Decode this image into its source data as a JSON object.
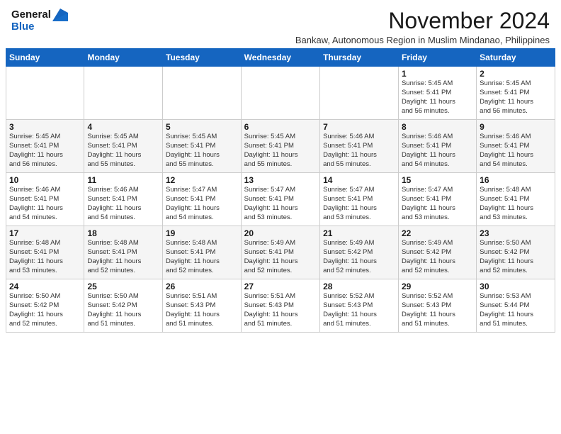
{
  "logo": {
    "general": "General",
    "blue": "Blue"
  },
  "header": {
    "month": "November 2024",
    "subtitle": "Bankaw, Autonomous Region in Muslim Mindanao, Philippines"
  },
  "weekdays": [
    "Sunday",
    "Monday",
    "Tuesday",
    "Wednesday",
    "Thursday",
    "Friday",
    "Saturday"
  ],
  "weeks": [
    [
      {
        "day": "",
        "info": ""
      },
      {
        "day": "",
        "info": ""
      },
      {
        "day": "",
        "info": ""
      },
      {
        "day": "",
        "info": ""
      },
      {
        "day": "",
        "info": ""
      },
      {
        "day": "1",
        "info": "Sunrise: 5:45 AM\nSunset: 5:41 PM\nDaylight: 11 hours\nand 56 minutes."
      },
      {
        "day": "2",
        "info": "Sunrise: 5:45 AM\nSunset: 5:41 PM\nDaylight: 11 hours\nand 56 minutes."
      }
    ],
    [
      {
        "day": "3",
        "info": "Sunrise: 5:45 AM\nSunset: 5:41 PM\nDaylight: 11 hours\nand 56 minutes."
      },
      {
        "day": "4",
        "info": "Sunrise: 5:45 AM\nSunset: 5:41 PM\nDaylight: 11 hours\nand 55 minutes."
      },
      {
        "day": "5",
        "info": "Sunrise: 5:45 AM\nSunset: 5:41 PM\nDaylight: 11 hours\nand 55 minutes."
      },
      {
        "day": "6",
        "info": "Sunrise: 5:45 AM\nSunset: 5:41 PM\nDaylight: 11 hours\nand 55 minutes."
      },
      {
        "day": "7",
        "info": "Sunrise: 5:46 AM\nSunset: 5:41 PM\nDaylight: 11 hours\nand 55 minutes."
      },
      {
        "day": "8",
        "info": "Sunrise: 5:46 AM\nSunset: 5:41 PM\nDaylight: 11 hours\nand 54 minutes."
      },
      {
        "day": "9",
        "info": "Sunrise: 5:46 AM\nSunset: 5:41 PM\nDaylight: 11 hours\nand 54 minutes."
      }
    ],
    [
      {
        "day": "10",
        "info": "Sunrise: 5:46 AM\nSunset: 5:41 PM\nDaylight: 11 hours\nand 54 minutes."
      },
      {
        "day": "11",
        "info": "Sunrise: 5:46 AM\nSunset: 5:41 PM\nDaylight: 11 hours\nand 54 minutes."
      },
      {
        "day": "12",
        "info": "Sunrise: 5:47 AM\nSunset: 5:41 PM\nDaylight: 11 hours\nand 54 minutes."
      },
      {
        "day": "13",
        "info": "Sunrise: 5:47 AM\nSunset: 5:41 PM\nDaylight: 11 hours\nand 53 minutes."
      },
      {
        "day": "14",
        "info": "Sunrise: 5:47 AM\nSunset: 5:41 PM\nDaylight: 11 hours\nand 53 minutes."
      },
      {
        "day": "15",
        "info": "Sunrise: 5:47 AM\nSunset: 5:41 PM\nDaylight: 11 hours\nand 53 minutes."
      },
      {
        "day": "16",
        "info": "Sunrise: 5:48 AM\nSunset: 5:41 PM\nDaylight: 11 hours\nand 53 minutes."
      }
    ],
    [
      {
        "day": "17",
        "info": "Sunrise: 5:48 AM\nSunset: 5:41 PM\nDaylight: 11 hours\nand 53 minutes."
      },
      {
        "day": "18",
        "info": "Sunrise: 5:48 AM\nSunset: 5:41 PM\nDaylight: 11 hours\nand 52 minutes."
      },
      {
        "day": "19",
        "info": "Sunrise: 5:48 AM\nSunset: 5:41 PM\nDaylight: 11 hours\nand 52 minutes."
      },
      {
        "day": "20",
        "info": "Sunrise: 5:49 AM\nSunset: 5:41 PM\nDaylight: 11 hours\nand 52 minutes."
      },
      {
        "day": "21",
        "info": "Sunrise: 5:49 AM\nSunset: 5:42 PM\nDaylight: 11 hours\nand 52 minutes."
      },
      {
        "day": "22",
        "info": "Sunrise: 5:49 AM\nSunset: 5:42 PM\nDaylight: 11 hours\nand 52 minutes."
      },
      {
        "day": "23",
        "info": "Sunrise: 5:50 AM\nSunset: 5:42 PM\nDaylight: 11 hours\nand 52 minutes."
      }
    ],
    [
      {
        "day": "24",
        "info": "Sunrise: 5:50 AM\nSunset: 5:42 PM\nDaylight: 11 hours\nand 52 minutes."
      },
      {
        "day": "25",
        "info": "Sunrise: 5:50 AM\nSunset: 5:42 PM\nDaylight: 11 hours\nand 51 minutes."
      },
      {
        "day": "26",
        "info": "Sunrise: 5:51 AM\nSunset: 5:43 PM\nDaylight: 11 hours\nand 51 minutes."
      },
      {
        "day": "27",
        "info": "Sunrise: 5:51 AM\nSunset: 5:43 PM\nDaylight: 11 hours\nand 51 minutes."
      },
      {
        "day": "28",
        "info": "Sunrise: 5:52 AM\nSunset: 5:43 PM\nDaylight: 11 hours\nand 51 minutes."
      },
      {
        "day": "29",
        "info": "Sunrise: 5:52 AM\nSunset: 5:43 PM\nDaylight: 11 hours\nand 51 minutes."
      },
      {
        "day": "30",
        "info": "Sunrise: 5:53 AM\nSunset: 5:44 PM\nDaylight: 11 hours\nand 51 minutes."
      }
    ]
  ]
}
